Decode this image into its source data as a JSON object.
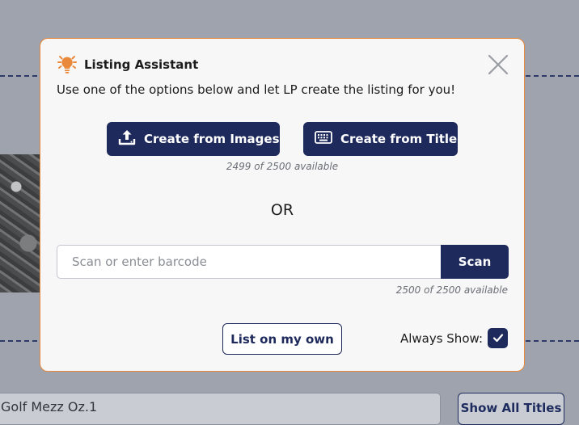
{
  "background": {
    "title_field_value": "Golf Mezz Oz.1",
    "show_all_titles_label": "Show All Titles"
  },
  "modal": {
    "title": "Listing Assistant",
    "subtitle": "Use one of the options below and let LP create the listing for you!",
    "create_from_images_label": "Create from Images",
    "create_from_title_label": "Create from Title",
    "image_availability": "2499 of 2500 available",
    "or_label": "OR",
    "barcode": {
      "placeholder": "Scan or enter barcode",
      "value": "",
      "scan_label": "Scan",
      "availability": "2500 of 2500 available"
    },
    "list_on_own_label": "List on my own",
    "always_show_label": "Always Show:",
    "always_show_checked": true
  },
  "icons": [
    "lightbulb-icon",
    "close-icon",
    "upload-icon",
    "keyboard-icon",
    "checkmark-icon"
  ],
  "colors": {
    "primary": "#1e2a5c",
    "accent_orange": "#e8893c",
    "overlay": "#9ea3ad"
  }
}
